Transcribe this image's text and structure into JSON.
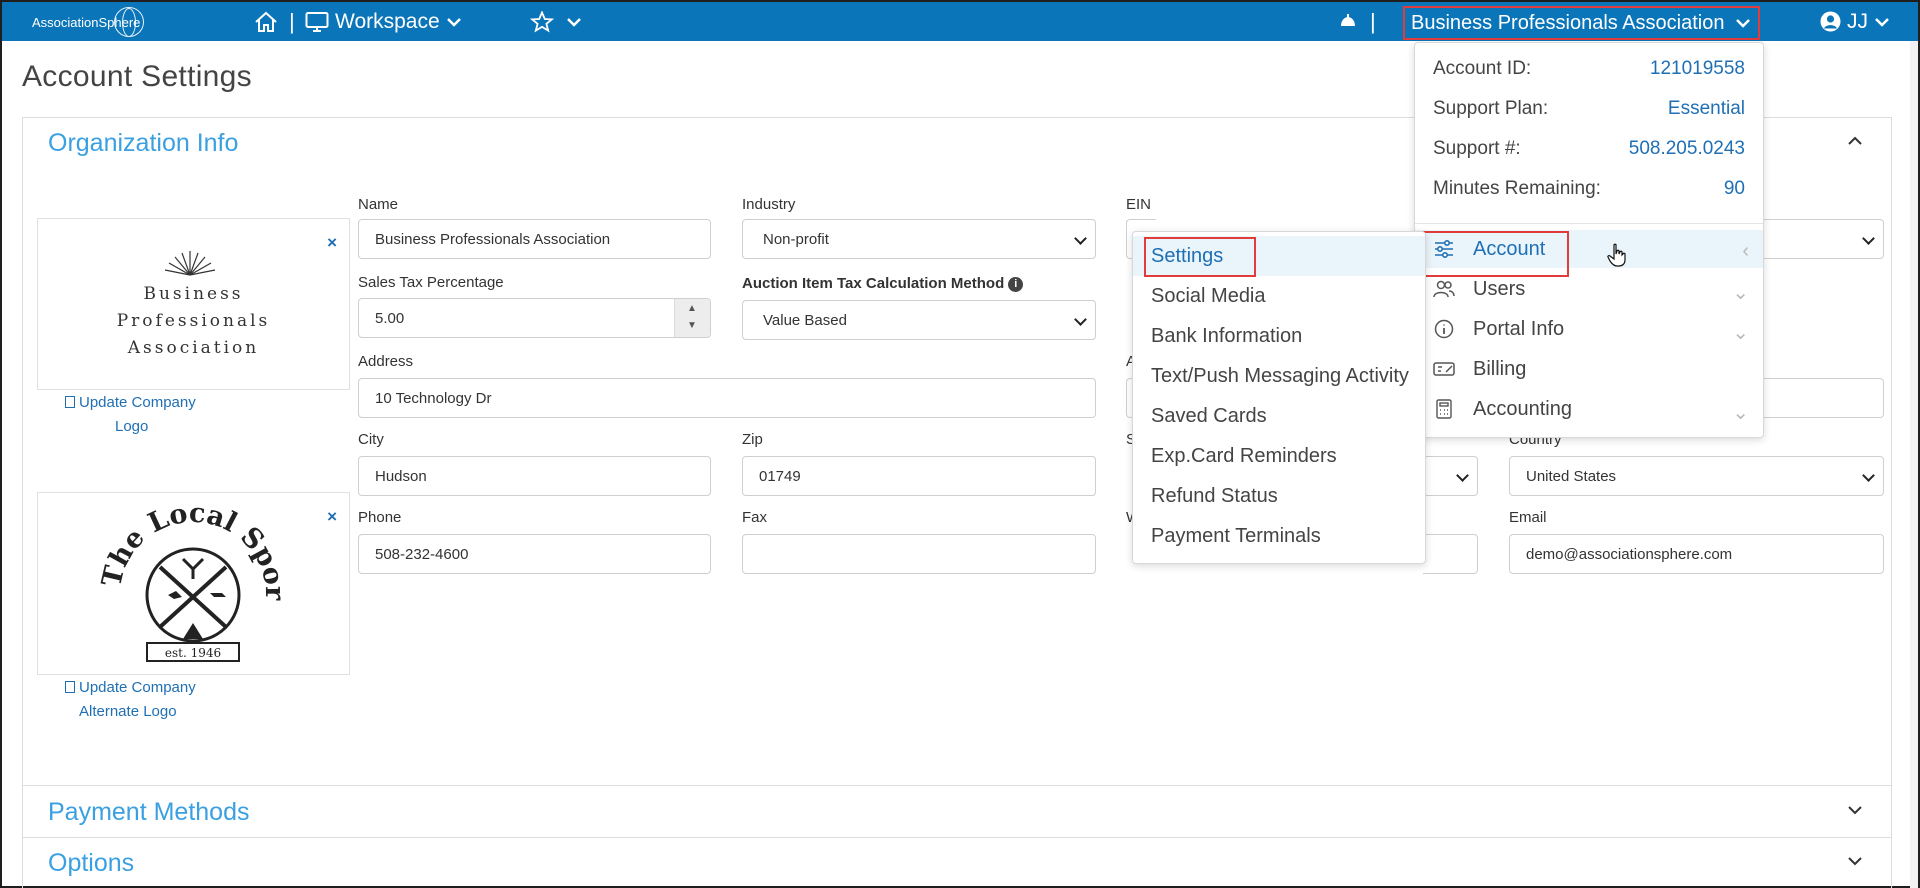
{
  "brand": {
    "name": "AssociationSphere"
  },
  "topbar": {
    "workspace_label": "Workspace",
    "separator": "|",
    "org_name": "Business Professionals Association",
    "user_initials": "JJ"
  },
  "page": {
    "title": "Account Settings"
  },
  "sections": {
    "org_info": "Organization Info",
    "payment_methods": "Payment Methods",
    "options": "Options"
  },
  "logos": {
    "primary_lines": [
      "Business",
      "Professionals",
      "Association"
    ],
    "primary_link": [
      "Update Company",
      "Logo"
    ],
    "alternate_text": "The Local Sportsman's Club",
    "alternate_est": "est. 1946",
    "alternate_link": [
      "Update Company",
      "Alternate Logo"
    ],
    "remove": "×"
  },
  "form": {
    "name_label": "Name",
    "name_value": "Business Professionals Association",
    "industry_label": "Industry",
    "industry_value": "Non-profit",
    "ein_label": "EIN",
    "tax_label": "Sales Tax Percentage",
    "tax_value": "5.00",
    "auction_label": "Auction Item Tax Calculation Method",
    "auction_value": "Value Based",
    "address_label": "Address",
    "address_value": "10 Technology Dr",
    "address2_label_partial": "A",
    "city_label": "City",
    "city_value": "Hudson",
    "zip_label": "Zip",
    "zip_value": "01749",
    "state_label_partial": "S",
    "country_label": "Country",
    "country_value": "United States",
    "phone_label": "Phone",
    "phone_value": "508-232-4600",
    "fax_label": "Fax",
    "fax_value": "",
    "website_label_partial": "W",
    "email_label": "Email",
    "email_value": "demo@associationsphere.com"
  },
  "account_panel": {
    "rows": [
      {
        "key": "Account ID:",
        "value": "121019558"
      },
      {
        "key": "Support Plan:",
        "value": "Essential"
      },
      {
        "key": "Support #:",
        "value": "508.205.0243"
      },
      {
        "key": "Minutes Remaining:",
        "value": "90"
      }
    ],
    "menu": [
      {
        "label": "Account",
        "icon": "sliders-icon"
      },
      {
        "label": "Users",
        "icon": "users-icon"
      },
      {
        "label": "Portal Info",
        "icon": "info-icon"
      },
      {
        "label": "Billing",
        "icon": "billing-icon"
      },
      {
        "label": "Accounting",
        "icon": "calculator-icon"
      }
    ]
  },
  "settings_submenu": [
    "Settings",
    "Social Media",
    "Bank Information",
    "Text/Push Messaging Activity",
    "Saved Cards",
    "Exp.Card Reminders",
    "Refund Status",
    "Payment Terminals"
  ],
  "colors": {
    "topbar": "#0b75b9",
    "accent": "#3aa0e1",
    "link": "#1f6fb5",
    "highlight": "#e23b3b"
  }
}
